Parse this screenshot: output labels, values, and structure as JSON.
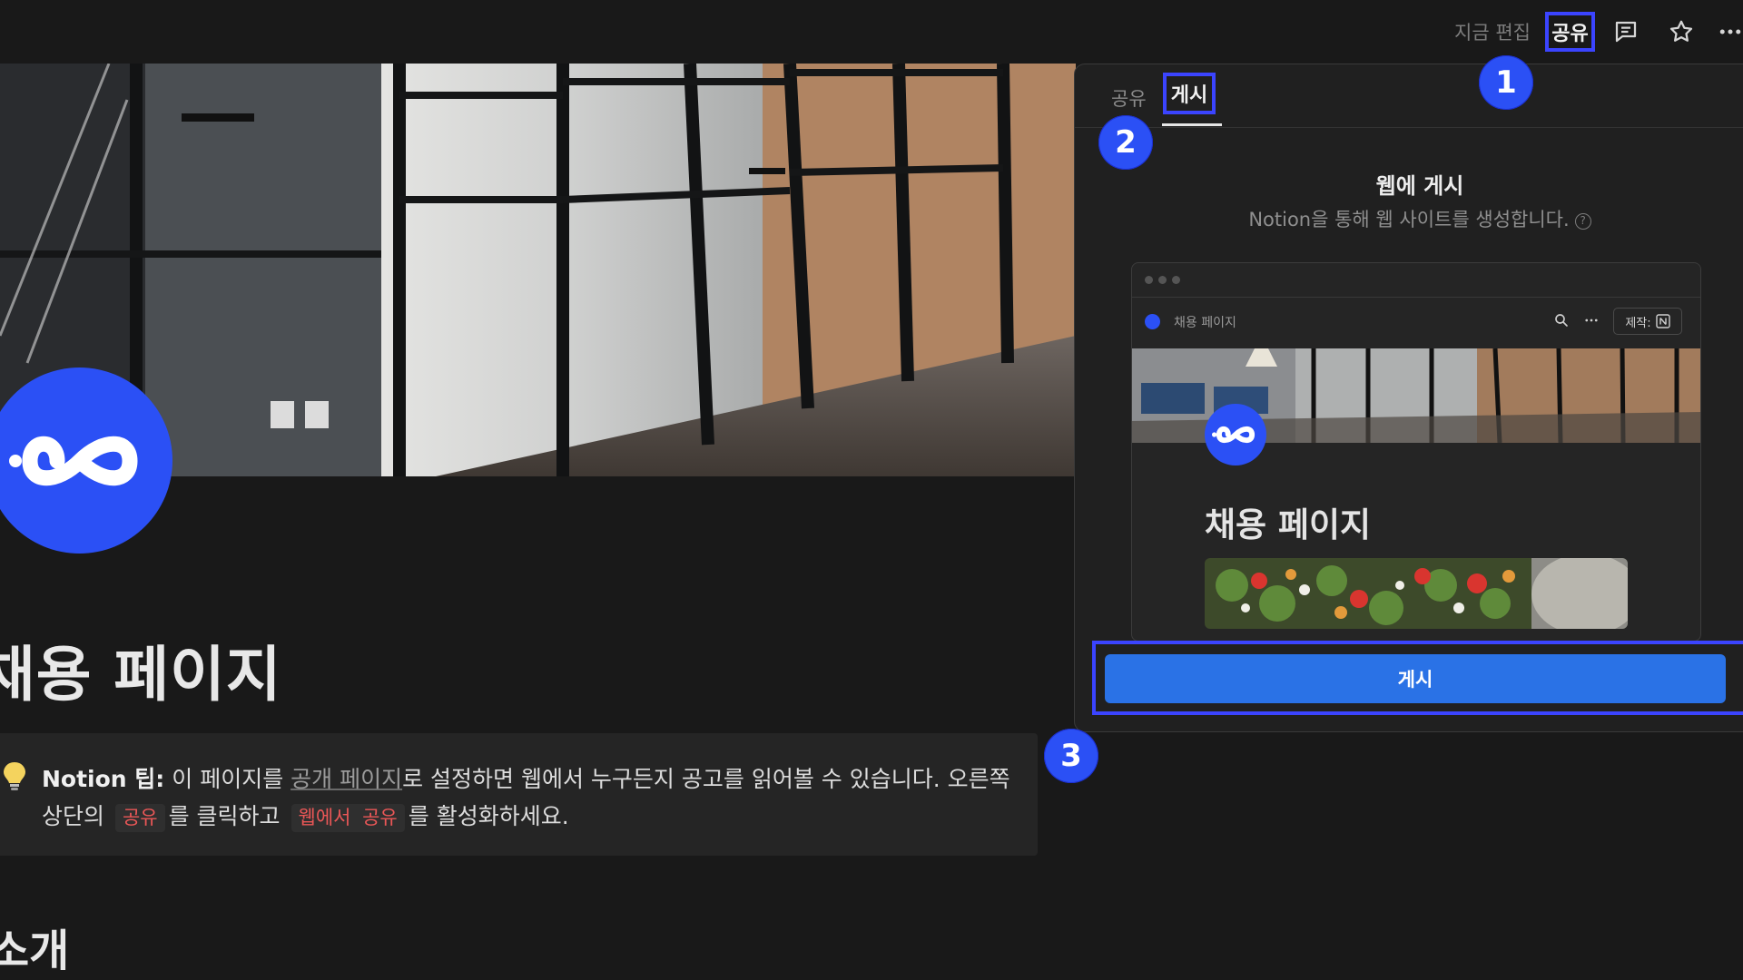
{
  "topbar": {
    "edited_label": "지금 편집",
    "share_label": "공유",
    "comment_icon": "comment-icon",
    "favorite_icon": "star-icon",
    "more_icon": "more-icon"
  },
  "page": {
    "title": "채용 페이지",
    "icon": "infinity-logo",
    "callout": {
      "icon": "lightbulb-icon",
      "lead": "Notion 팁:",
      "text_1": " 이 페이지를 ",
      "link": "공개 페이지",
      "text_2": "로 설정하면 웹에서 누구든지 공고를 읽어볼 수 있습니다. 오른쪽 상단의 ",
      "chip_1": "공유",
      "text_3": "를 클릭하고 ",
      "chip_2": "웹에서 공유",
      "text_4": "를 활성화하세요."
    },
    "section_heading": "소개"
  },
  "panel": {
    "tabs": [
      {
        "label": "공유",
        "active": false
      },
      {
        "label": "게시",
        "active": true
      }
    ],
    "publish_title": "웹에 게시",
    "publish_description": "Notion을 통해 웹 사이트를 생성합니다.",
    "help_icon": "?",
    "preview": {
      "page_name": "채용 페이지",
      "made_with_label": "제작:",
      "title": "채용 페이지"
    },
    "publish_button_label": "게시"
  },
  "steps": [
    "1",
    "2",
    "3"
  ],
  "colors": {
    "highlight": "#3b44ff",
    "step_badge": "#2b50f5",
    "publish_button": "#2a72e6",
    "code_text": "#eb5757",
    "background": "#191919"
  }
}
